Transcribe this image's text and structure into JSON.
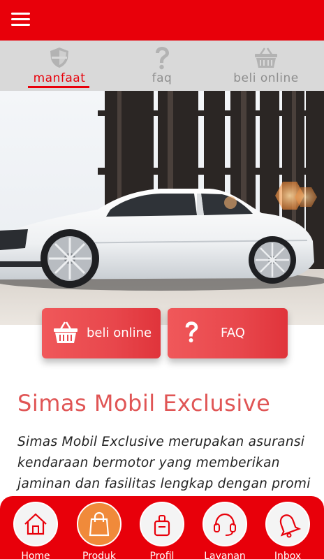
{
  "header": {
    "menu_icon": "hamburger-icon"
  },
  "tabs": [
    {
      "label": "manfaat",
      "icon": "shield-icon",
      "active": true
    },
    {
      "label": "faq",
      "icon": "question-icon",
      "active": false
    },
    {
      "label": "beli online",
      "icon": "basket-icon",
      "active": false
    }
  ],
  "hero": {
    "image": "white-sedan-photo"
  },
  "cta": {
    "buy_label": "beli online",
    "faq_label": "FAQ"
  },
  "content": {
    "title": "Simas Mobil Exclusive",
    "paragraph": "Simas Mobil Exclusive merupakan asuransi kendaraan bermotor yang memberikan jaminan dan fasilitas lengkap dengan promi terjangkau, sehingga memudahkan"
  },
  "bottom_nav": [
    {
      "label": "Home",
      "icon": "home-icon"
    },
    {
      "label": "Produk",
      "icon": "shopping-bag-icon",
      "active": true
    },
    {
      "label": "Profil",
      "icon": "profile-icon"
    },
    {
      "label": "Layanan",
      "icon": "headset-icon"
    },
    {
      "label": "Inbox",
      "icon": "bell-icon"
    }
  ],
  "colors": {
    "primary": "#e8000a",
    "accent_orange": "#f08a3a",
    "title_red": "#e05555"
  }
}
